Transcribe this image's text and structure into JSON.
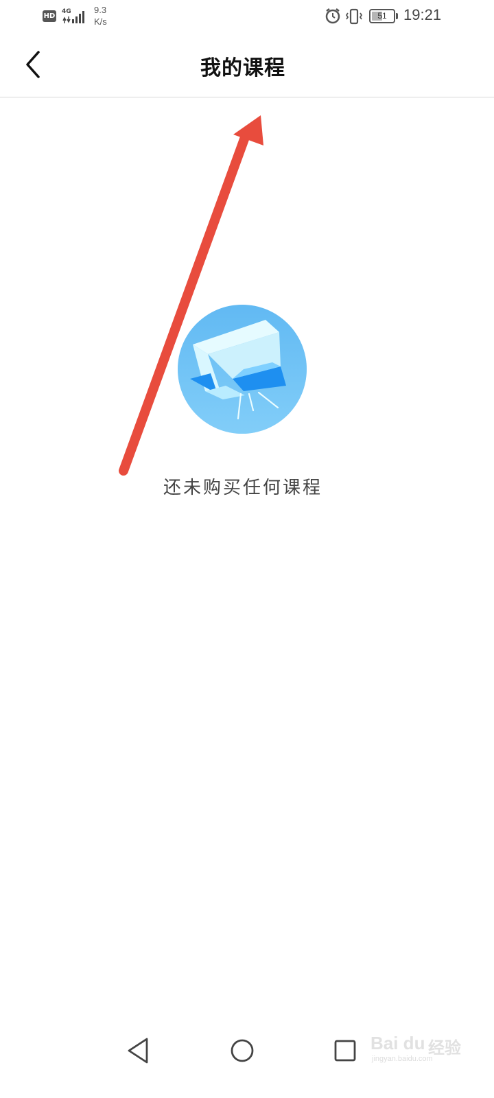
{
  "status_bar": {
    "hd": "HD",
    "network": "4G",
    "speed_value": "9.3",
    "speed_unit": "K/s",
    "battery": "51",
    "battery_fraction": 0.51,
    "time": "19:21",
    "icons": [
      "alarm-icon",
      "vibrate-icon",
      "battery-icon"
    ]
  },
  "header": {
    "title": "我的课程",
    "back_icon": "chevron-left-icon"
  },
  "empty_state": {
    "message": "还未购买任何课程",
    "illustration": "empty-box-icon"
  },
  "annotation": {
    "color": "#e84c3d"
  },
  "nav_bar": {
    "items": [
      "back-triangle-icon",
      "home-circle-icon",
      "recents-square-icon"
    ]
  },
  "watermark": {
    "brand": "Bai du",
    "cn": "经验",
    "url": "jingyan.baidu.com"
  },
  "colors": {
    "background": "#ffffff",
    "illustration_blue": "#6ec3f5",
    "illustration_dark_blue": "#1e8ff0"
  }
}
